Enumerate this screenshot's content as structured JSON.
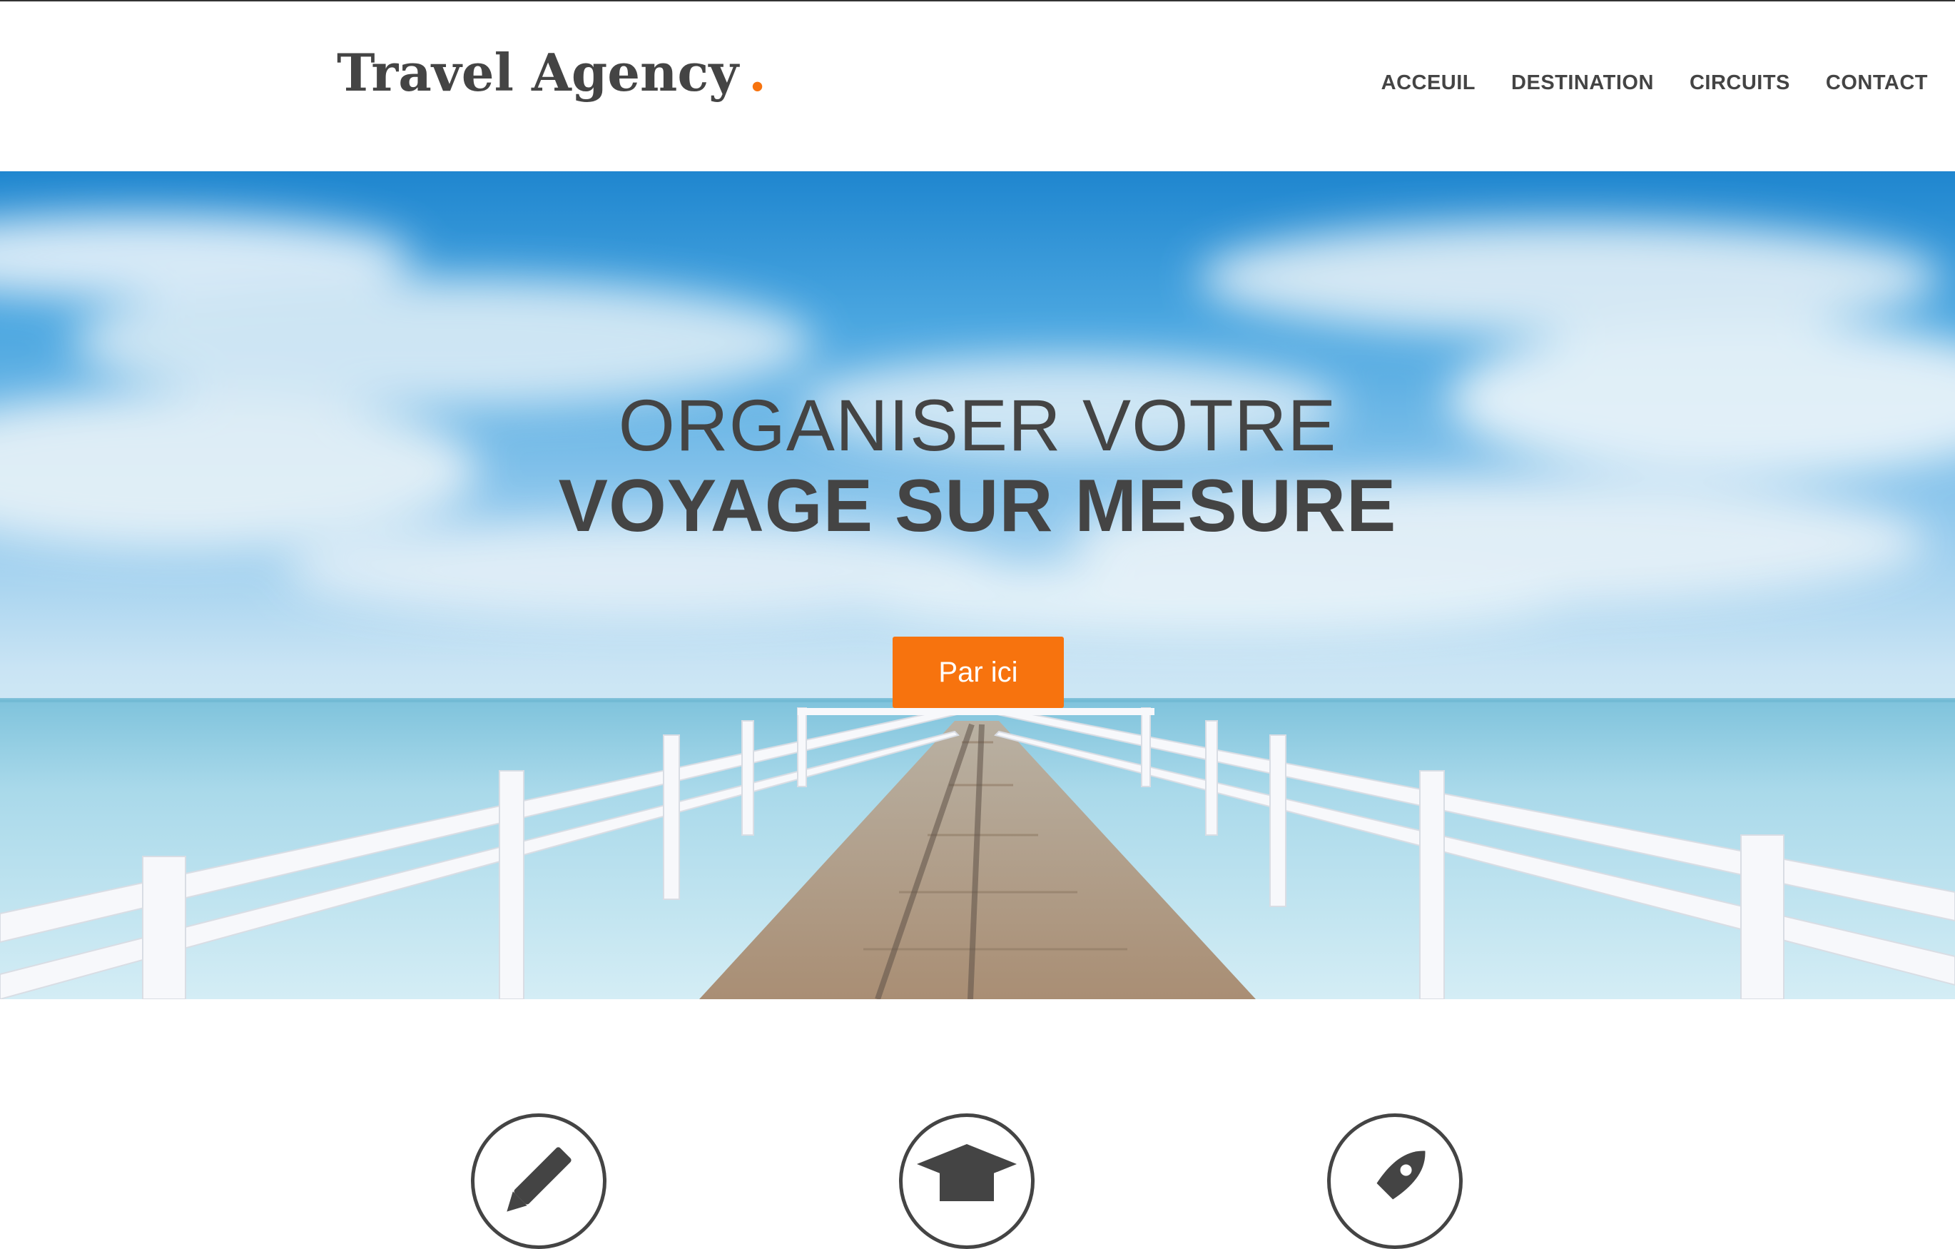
{
  "header": {
    "logo_text": "Travel Agency",
    "logo_dot": ".",
    "nav": [
      "ACCEUIL",
      "DESTINATION",
      "CIRCUITS",
      "CONTACT"
    ]
  },
  "hero": {
    "line1": "ORGANISER VOTRE",
    "line2": "VOYAGE SUR MESURE",
    "cta_label": "Par ici"
  },
  "features": {
    "icons": [
      "pencil-icon",
      "graduation-cap-icon",
      "rocket-icon"
    ]
  },
  "colors": {
    "accent": "#f7730e",
    "text": "#444444",
    "background": "#ffffff"
  }
}
